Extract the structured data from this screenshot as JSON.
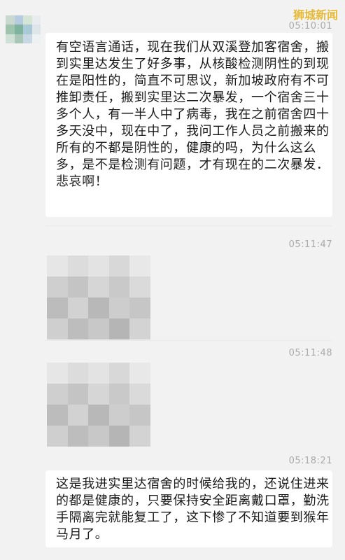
{
  "watermark": "狮城新闻",
  "messages": [
    {
      "time": "05:10:01",
      "text": "有空语言通话，现在我们从双溪登加客宿舍，搬到实里达发生了好多事，从核酸检测阴性的到现在是阳性的，简直不可思议，新加坡政府有不可推卸责任，搬到实里达二次暴发，一个宿舍三十多个人，有一半人中了病毒，我在之前宿舍四十多天没中，现在中了，我问工作人员之前搬来的所有的不都是阴性的，健康的吗，为什么这么多，是不是检测有问题，才有现在的二次暴发．悲哀啊！"
    },
    {
      "time": "05:11:47",
      "type": "image"
    },
    {
      "time": "05:11:48",
      "type": "image"
    },
    {
      "time": "05:18:21",
      "text": "这是我进实里达宿舍的时候给我的，还说住进来的都是健康的，只要保持安全距离戴口罩，勤洗手隔离完就能复工了，这下惨了不知道要到猴年马月了。"
    }
  ],
  "colors": {
    "background": "#f2f2f2",
    "bubble": "#ffffff",
    "watermark": "#e5b83a",
    "timestamp": "#aaaaaa"
  }
}
